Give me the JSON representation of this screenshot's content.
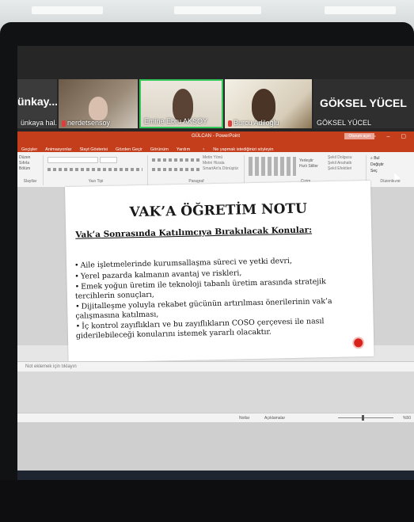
{
  "video": {
    "tile1_big": "ünkay...",
    "tile1_name": "ünkaya hal...",
    "tile2_name": "nerdetsensoy",
    "tile3_name": "Emine Ebru AKSOY",
    "tile4_name": "Burcu Adiloğlu",
    "tile5_big": "GÖKSEL YÜCEL",
    "tile5_name": "GÖKSEL YÜCEL"
  },
  "ppt": {
    "doc_title": "GÜLCAN - PowerPoint",
    "signin": "Oturum açın",
    "tabs": [
      "Geçişler",
      "Animasyonlar",
      "Slayt Gösterisi",
      "Gözden Geçir",
      "Görünüm",
      "Yardım",
      "Ne yapmak istediğinizi söyleyin"
    ],
    "ribbon_groups": [
      "Slaytlar",
      "Yazı Tipi",
      "Paragraf",
      "Çizim",
      "Düzenleme"
    ],
    "ribbon_left": [
      "Düzen",
      "Sıfırla",
      "Bölüm"
    ],
    "ribbon_right": [
      "Bul",
      "Değiştir",
      "Seç"
    ],
    "ribbon_draw": [
      "Yerleştir",
      "Hızlı Stiller",
      "Şekil Dolgusu",
      "Şekil Anahattı",
      "Şekil Efektleri"
    ],
    "ribbon_para": [
      "Metin Yönü",
      "Metni Hizala",
      "SmartArt'a Dönüştür"
    ],
    "notes_placeholder": "Not eklemek için tıklayın",
    "status_notes": "Notlar",
    "status_comments": "Açıklamalar",
    "zoom": "%50"
  },
  "slide": {
    "title": "VAK’A ÖĞRETİM NOTU",
    "subtitle": "Vak’a Sonrasında Katılımcıya Bırakılacak Konular:",
    "bullets": [
      "Aile işletmelerinde kurumsallaşma süreci ve yetki devri,",
      "Yerel pazarda kalmanın avantaj ve riskleri,",
      "Emek yoğun üretim ile teknoloji tabanlı üretim arasında stratejik tercihlerin sonuçları,",
      "Dijitalleşme yoluyla rekabet gücünün artırılması önerilerinin vak’a çalışmasına katılması,",
      "İç kontrol zayıflıkları ve bu zayıflıkların COSO çerçevesi ile nasıl giderilebileceği konularını istemek yararlı olacaktır."
    ]
  }
}
